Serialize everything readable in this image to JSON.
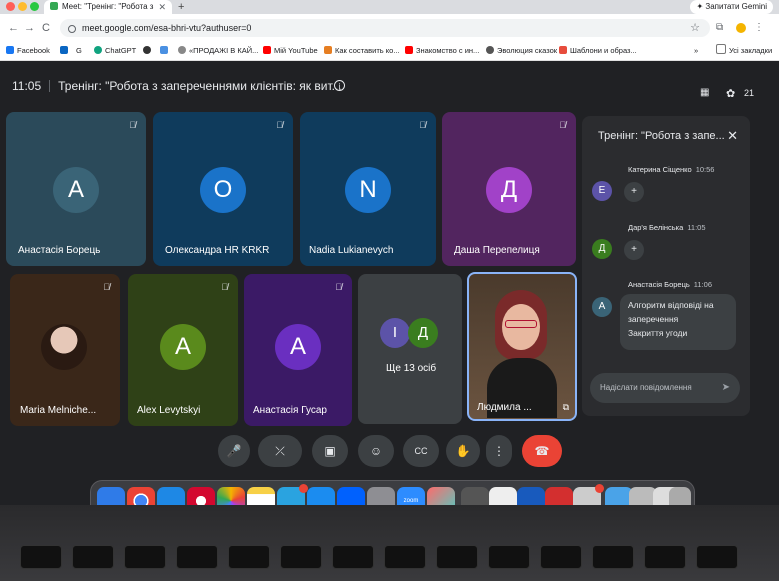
{
  "browser": {
    "tab_title": "Meet: \"Тренінг: \"Робота з",
    "tab_close": "✕",
    "new_tab": "+",
    "gemini_button": "Запитати Gemini",
    "url": "meet.google.com/esa-bhri-vtu?authuser=0",
    "nav": {
      "back": "←",
      "forward": "→",
      "reload": "C"
    },
    "bookmarks": [
      {
        "label": "Facebook",
        "color": "#1877f2"
      },
      {
        "label": "G",
        "color": "#4285f4"
      },
      {
        "label": "ChatGPT",
        "color": "#10a37f"
      },
      {
        "label": "«ПРОДАЖІ В КАЙ...",
        "color": "#4a90e2"
      },
      {
        "label": "Мій YouTube",
        "color": "#ff0000"
      },
      {
        "label": "Как составить ко...",
        "color": "#e67e22"
      },
      {
        "label": "Знакомство с ин...",
        "color": "#ff0000"
      },
      {
        "label": "Эволюция сказок",
        "color": "#555555"
      },
      {
        "label": "Шаблони и образ...",
        "color": "#e74c3c"
      },
      {
        "label": "Усі закладки",
        "color": "#777777"
      }
    ]
  },
  "meet": {
    "time": "11:05",
    "title": "Тренінг: \"Робота з запереченнями клієнтів: як вит...",
    "people_count": "21",
    "tiles": [
      {
        "initial": "A",
        "name": "Анастасія Борець",
        "bg": "#2b4a5a",
        "avatar_bg": "#3a6477"
      },
      {
        "initial": "O",
        "name": "Олександра HR KRKR",
        "bg": "#0f3b5c",
        "avatar_bg": "#1a73c9"
      },
      {
        "initial": "N",
        "name": "Nadia Lukianevych",
        "bg": "#0f3b5c",
        "avatar_bg": "#1a73c9"
      },
      {
        "initial": "Д",
        "name": "Даша Перепелиця",
        "bg": "#52255f",
        "avatar_bg": "#a142c8"
      },
      {
        "initial": "",
        "name": "Maria Melniche...",
        "bg": "#3a2719",
        "avatar_bg": "#c9a89a"
      },
      {
        "initial": "A",
        "name": "Alex Levytskyi",
        "bg": "#2f4117",
        "avatar_bg": "#5a8a1c"
      },
      {
        "initial": "A",
        "name": "Анастасія Гусар",
        "bg": "#3b1a66",
        "avatar_bg": "#6a2fc0"
      },
      {
        "initial": "",
        "name": "Ще 13 осіб",
        "bg": "#3c4043",
        "avatar_bg": "#3c4043"
      },
      {
        "initial": "",
        "name": "Людмила ...",
        "bg": "#5a4a3a",
        "avatar_bg": "#8a6a50"
      }
    ],
    "more_initials": [
      "І",
      "Д"
    ]
  },
  "chat": {
    "title": "Тренінг: \"Робота з запе...",
    "close": "✕",
    "messages": [
      {
        "author": "Катерина Сіщенко",
        "time": "10:56",
        "initial": "Е",
        "color": "#5c53a8",
        "content": "+"
      },
      {
        "author": "Дар'я Белінська",
        "time": "11:05",
        "initial": "Д",
        "color": "#3a7d1f",
        "content": "+"
      },
      {
        "author": "Анастасія Борець",
        "time": "11:06",
        "initial": "A",
        "color": "#3a6477",
        "line1": "Алгоритм відповіді на",
        "line2": "заперечення",
        "line3": "Закриття угоди"
      }
    ],
    "input_placeholder": "Надіслати повідомлення"
  },
  "controls": {
    "mic": "🎤",
    "camera": "⤫",
    "present": "▣",
    "emoji": "☺",
    "captions": "CC",
    "hand": "✋",
    "more": "⋮",
    "end": "☎"
  }
}
